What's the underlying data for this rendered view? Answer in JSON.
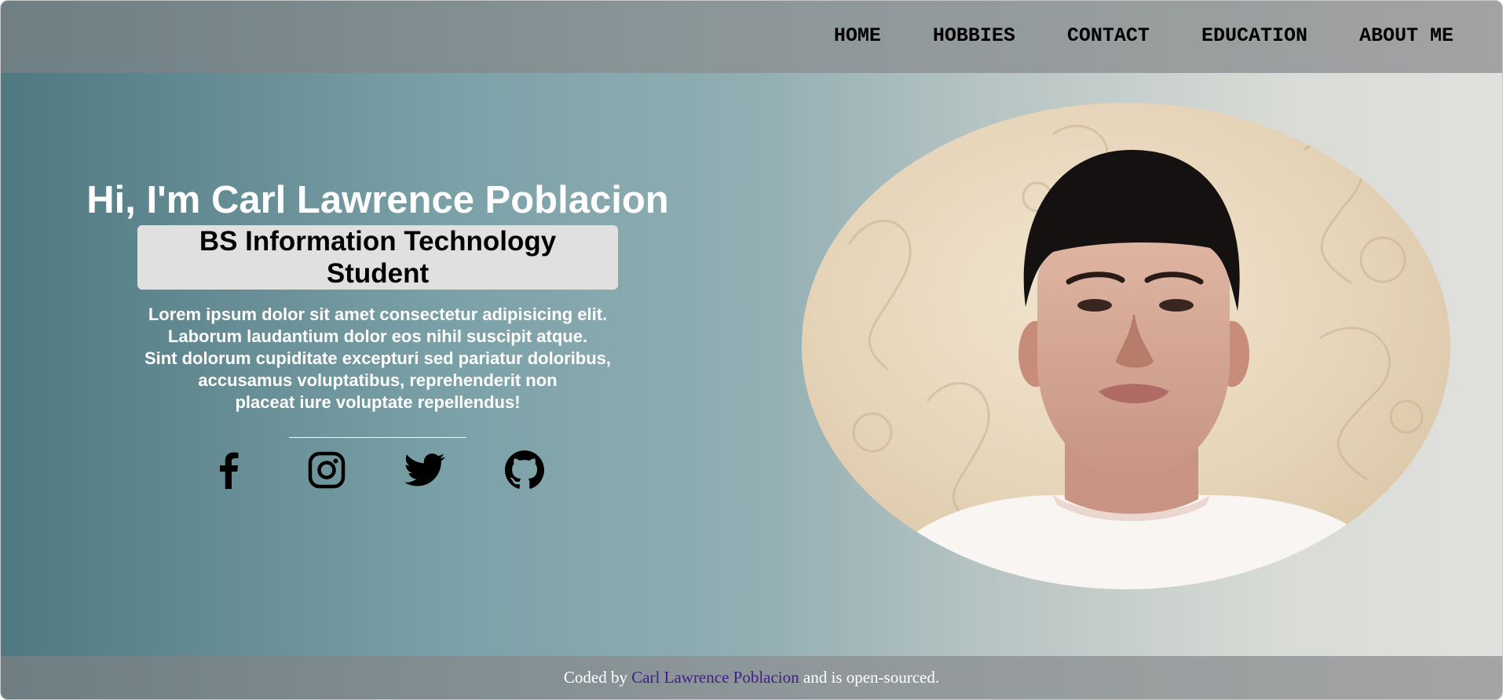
{
  "nav": {
    "items": [
      {
        "label": "HOME"
      },
      {
        "label": "HOBBIES"
      },
      {
        "label": "CONTACT"
      },
      {
        "label": "EDUCATION"
      },
      {
        "label": "ABOUT ME"
      }
    ]
  },
  "hero": {
    "title": "Hi, I'm Carl Lawrence Poblacion",
    "subtitle": "BS Information Technology Student",
    "description_lines": [
      "Lorem ipsum dolor sit amet consectetur adipisicing elit.",
      "Laborum laudantium dolor eos nihil suscipit atque.",
      "Sint dolorum cupiditate excepturi sed pariatur doloribus,",
      "accusamus voluptatibus, reprehenderit non",
      "placeat iure voluptate repellendus!"
    ],
    "socials": [
      {
        "icon": "facebook-icon"
      },
      {
        "icon": "instagram-icon"
      },
      {
        "icon": "twitter-icon"
      },
      {
        "icon": "github-icon"
      }
    ]
  },
  "footer": {
    "prefix": "Coded by",
    "author": "Carl Lawrence Poblacion",
    "suffix": "and is open-sourced."
  },
  "colors": {
    "footer_link": "#3f1e8a",
    "subtitle_bg": "#e0e0e0"
  }
}
